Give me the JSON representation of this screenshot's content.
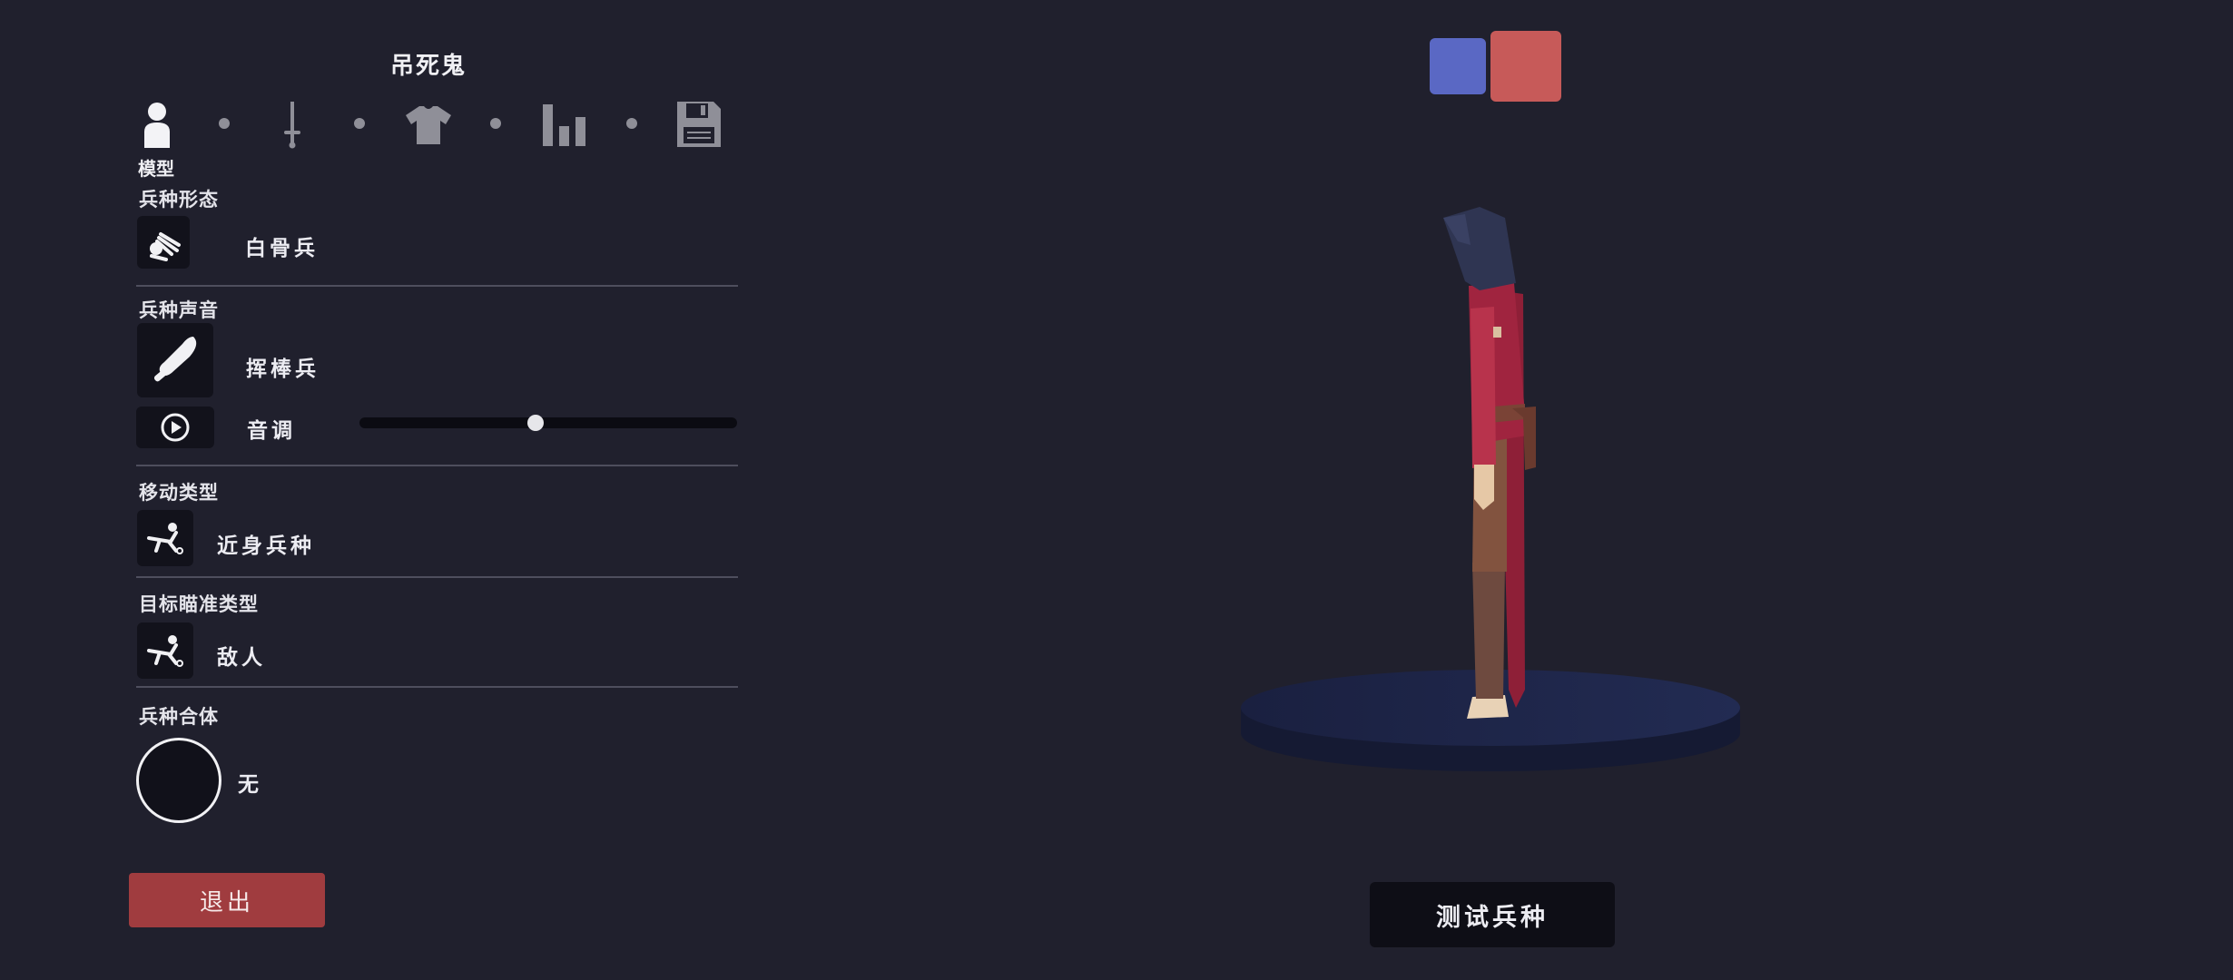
{
  "header": {
    "title": "吊死鬼"
  },
  "tabs": [
    {
      "icon": "person-icon",
      "label": "模型"
    },
    {
      "icon": "sword-icon"
    },
    {
      "icon": "shirt-icon"
    },
    {
      "icon": "stats-icon"
    },
    {
      "icon": "save-icon"
    }
  ],
  "sections": {
    "form": {
      "label": "兵种形态",
      "value": "白骨兵"
    },
    "voice": {
      "label": "兵种声音",
      "value": "挥棒兵",
      "pitch_label": "音调",
      "pitch_level": 0.5
    },
    "movement": {
      "label": "移动类型",
      "value": "近身兵种"
    },
    "targeting": {
      "label": "目标瞄准类型",
      "value": "敌人"
    },
    "combo": {
      "label": "兵种合体",
      "value": "无"
    }
  },
  "buttons": {
    "exit": "退出",
    "test": "测试兵种"
  },
  "colors": {
    "team_blue": "#5a68c4",
    "team_red": "#c75a59",
    "exit_button": "#a03c3f"
  }
}
